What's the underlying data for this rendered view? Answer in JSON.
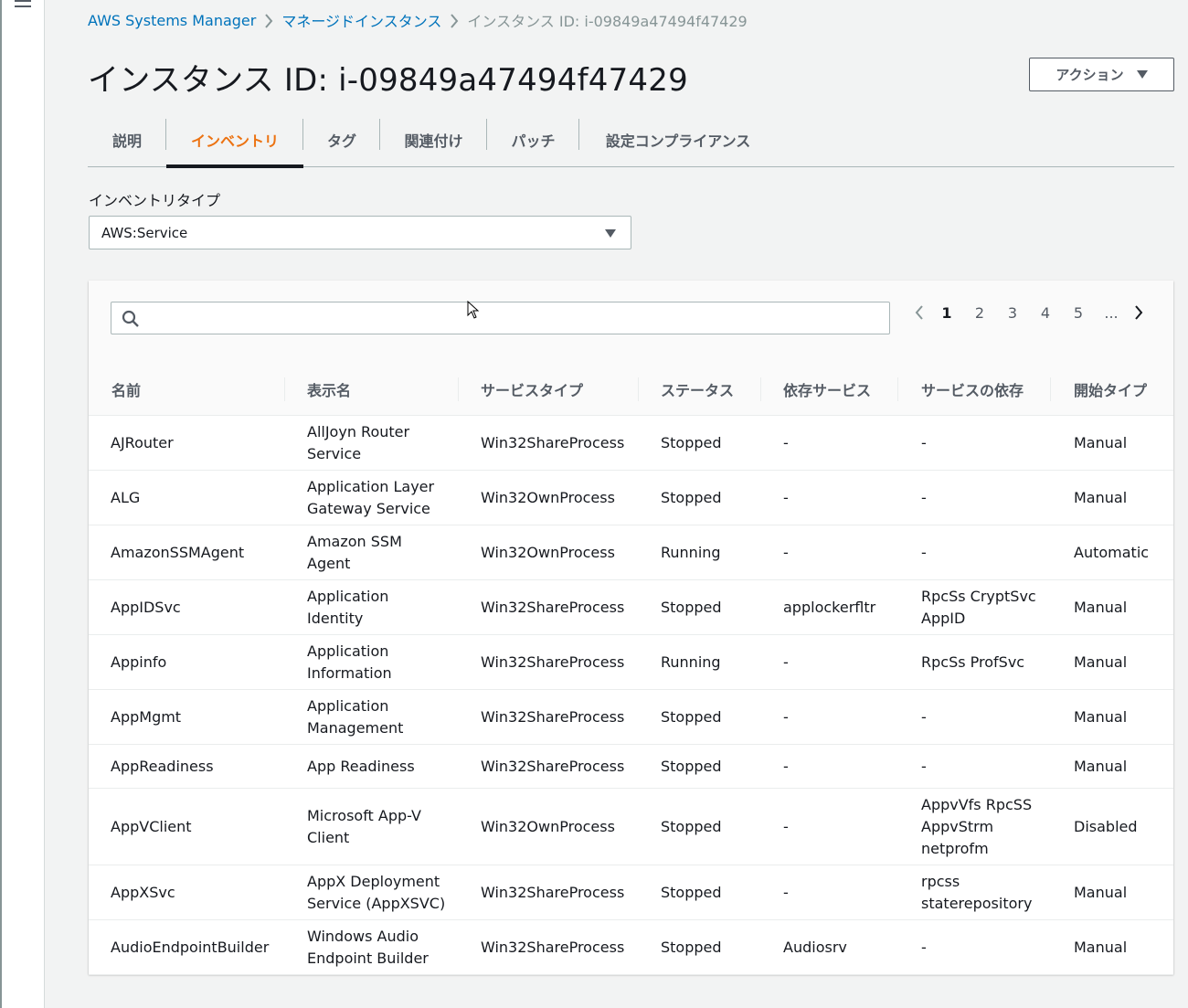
{
  "breadcrumb": {
    "root": "AWS Systems Manager",
    "parent": "マネージドインスタンス",
    "current": "インスタンス ID: i-09849a47494f47429"
  },
  "page": {
    "title": "インスタンス ID: i-09849a47494f47429",
    "action_label": "アクション"
  },
  "tabs": [
    {
      "label": "説明"
    },
    {
      "label": "インベントリ",
      "active": true
    },
    {
      "label": "タグ"
    },
    {
      "label": "関連付け"
    },
    {
      "label": "パッチ"
    },
    {
      "label": "設定コンプライアンス"
    }
  ],
  "inventory": {
    "label": "インベントリタイプ",
    "selected": "AWS:Service"
  },
  "search": {
    "placeholder": ""
  },
  "pagination": {
    "pages": [
      "1",
      "2",
      "3",
      "4",
      "5",
      "..."
    ],
    "current": "1"
  },
  "table": {
    "columns": [
      "名前",
      "表示名",
      "サービスタイプ",
      "ステータス",
      "依存サービス",
      "サービスの依存",
      "開始タイプ"
    ],
    "rows": [
      [
        "AJRouter",
        "AllJoyn Router\nService",
        "Win32ShareProcess",
        "Stopped",
        "-",
        "-",
        "Manual"
      ],
      [
        "ALG",
        "Application Layer\nGateway Service",
        "Win32OwnProcess",
        "Stopped",
        "-",
        "-",
        "Manual"
      ],
      [
        "AmazonSSMAgent",
        "Amazon SSM\nAgent",
        "Win32OwnProcess",
        "Running",
        "-",
        "-",
        "Automatic"
      ],
      [
        "AppIDSvc",
        "Application\nIdentity",
        "Win32ShareProcess",
        "Stopped",
        "applockerfltr",
        "RpcSs CryptSvc\nAppID",
        "Manual"
      ],
      [
        "Appinfo",
        "Application\nInformation",
        "Win32ShareProcess",
        "Running",
        "-",
        "RpcSs ProfSvc",
        "Manual"
      ],
      [
        "AppMgmt",
        "Application\nManagement",
        "Win32ShareProcess",
        "Stopped",
        "-",
        "-",
        "Manual"
      ],
      [
        "AppReadiness",
        "App Readiness",
        "Win32ShareProcess",
        "Stopped",
        "-",
        "-",
        "Manual"
      ],
      [
        "AppVClient",
        "Microsoft App-V\nClient",
        "Win32OwnProcess",
        "Stopped",
        "-",
        "AppvVfs RpcSS\nAppvStrm\nnetprofm",
        "Disabled"
      ],
      [
        "AppXSvc",
        "AppX Deployment\nService (AppXSVC)",
        "Win32ShareProcess",
        "Stopped",
        "-",
        "rpcss\nstaterepository",
        "Manual"
      ],
      [
        "AudioEndpointBuilder",
        "Windows Audio\nEndpoint Builder",
        "Win32ShareProcess",
        "Stopped",
        "Audiosrv",
        "-",
        "Manual"
      ]
    ]
  }
}
